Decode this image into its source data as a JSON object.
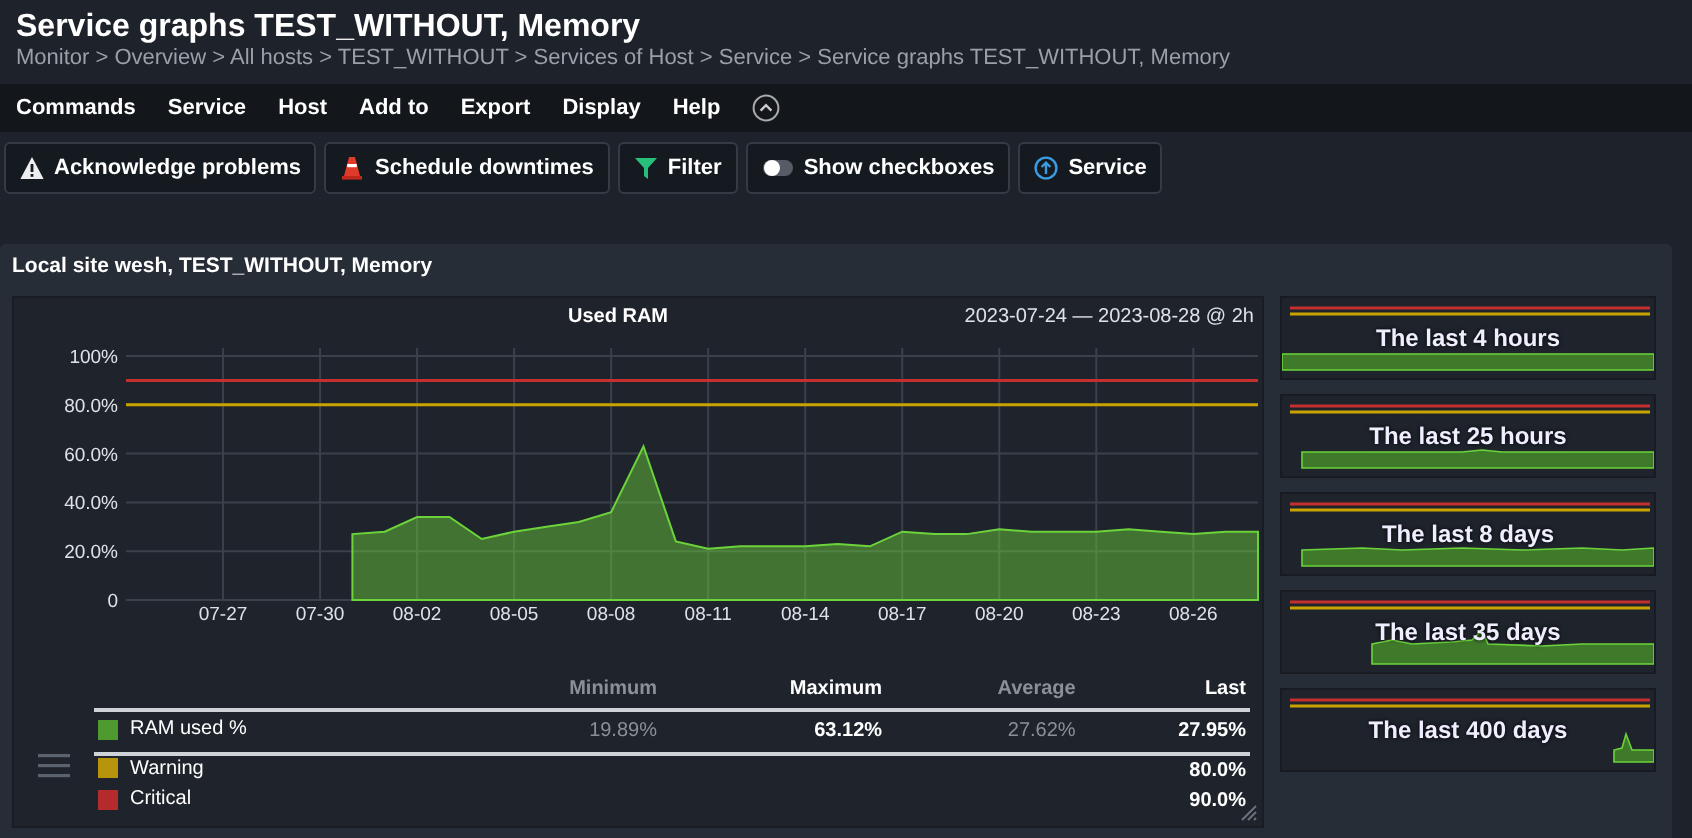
{
  "header": {
    "title": "Service graphs TEST_WITHOUT, Memory",
    "breadcrumb": "Monitor > Overview > All hosts > TEST_WITHOUT > Services of Host > Service > Service graphs TEST_WITHOUT, Memory"
  },
  "menu": [
    "Commands",
    "Service",
    "Host",
    "Add to",
    "Export",
    "Display",
    "Help"
  ],
  "toolbar": [
    {
      "label": "Acknowledge problems",
      "kind": "warning"
    },
    {
      "label": "Schedule downtimes",
      "kind": "cone"
    },
    {
      "label": "Filter",
      "kind": "filter"
    },
    {
      "label": "Show checkboxes",
      "kind": "toggle"
    },
    {
      "label": "Service",
      "kind": "up"
    }
  ],
  "panel": {
    "title": "Local site wesh, TEST_WITHOUT, Memory",
    "graph": {
      "range": "2023-07-24 — 2023-08-28 @ 2h",
      "chart_data": {
        "type": "area",
        "title": "Used RAM",
        "categories": [
          null,
          null,
          null,
          "07-27",
          null,
          null,
          "07-30",
          null,
          null,
          "08-02",
          null,
          null,
          "08-05",
          null,
          null,
          "08-08",
          null,
          null,
          "08-11",
          null,
          null,
          "08-14",
          null,
          null,
          "08-17",
          null,
          null,
          "08-20",
          null,
          null,
          "08-23",
          null,
          null,
          "08-26",
          null,
          null
        ],
        "series": [
          {
            "name": "RAM used %",
            "color": "#6cd43a",
            "values": [
              null,
              null,
              null,
              null,
              null,
              null,
              null,
              27,
              28,
              34,
              34,
              25,
              28,
              30,
              32,
              36,
              63,
              24,
              21,
              22,
              22,
              22,
              23,
              22,
              28,
              27,
              27,
              29,
              28,
              28,
              28,
              29,
              28,
              27,
              28,
              28
            ]
          }
        ],
        "ylim": [
          0,
          100
        ],
        "yticks": [
          {
            "value": 0,
            "label": "0"
          },
          {
            "value": 20,
            "label": "20.0%"
          },
          {
            "value": 40,
            "label": "40.0%"
          },
          {
            "value": 60,
            "label": "60.0%"
          },
          {
            "value": 80,
            "label": "80.0%"
          },
          {
            "value": 100,
            "label": "100%"
          }
        ],
        "grid": true,
        "ref_lines": [
          {
            "axis": "y",
            "value": 90,
            "color": "#c62f2f"
          },
          {
            "axis": "y",
            "value": 80,
            "color": "#c9a400"
          }
        ]
      },
      "legend": {
        "columns": [
          "Minimum",
          "Maximum",
          "Average",
          "Last"
        ],
        "rows": [
          {
            "color": "#4e9a2e",
            "minimum": "19.89%",
            "maximum": "63.12%",
            "average": "27.62%",
            "last": "27.95%"
          },
          {
            "name": "Warning",
            "color": "#b8930c",
            "last": "80.0%"
          },
          {
            "name": "Critical",
            "color": "#b52a2a",
            "last": "90.0%"
          }
        ]
      }
    }
  },
  "thumbnails": [
    {
      "title": "The last 4 hours"
    },
    {
      "title": "The last 25 hours"
    },
    {
      "title": "The last 8 days"
    },
    {
      "title": "The last 35 days"
    },
    {
      "title": "The last 400 days"
    }
  ]
}
